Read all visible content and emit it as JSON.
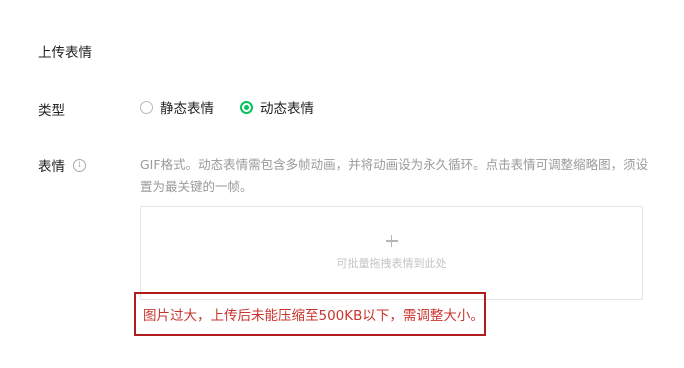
{
  "section": {
    "title": "上传表情"
  },
  "type_row": {
    "label": "类型",
    "options": [
      {
        "label": "静态表情",
        "selected": false
      },
      {
        "label": "动态表情",
        "selected": true
      }
    ]
  },
  "sticker_row": {
    "label": "表情",
    "info_icon": "info-icon",
    "description": "GIF格式。动态表情需包含多帧动画，并将动画设为永久循环。点击表情可调整缩略图，须设置为最关键的一帧。",
    "dropzone": {
      "icon": "plus-icon",
      "hint": "可批量拖拽表情到此处"
    }
  },
  "error": {
    "message": "图片过大，上传后未能压缩至500KB以下，需调整大小。"
  },
  "colors": {
    "accent": "#07c160",
    "error_text": "#c9342e",
    "error_border": "#b11d1d"
  }
}
